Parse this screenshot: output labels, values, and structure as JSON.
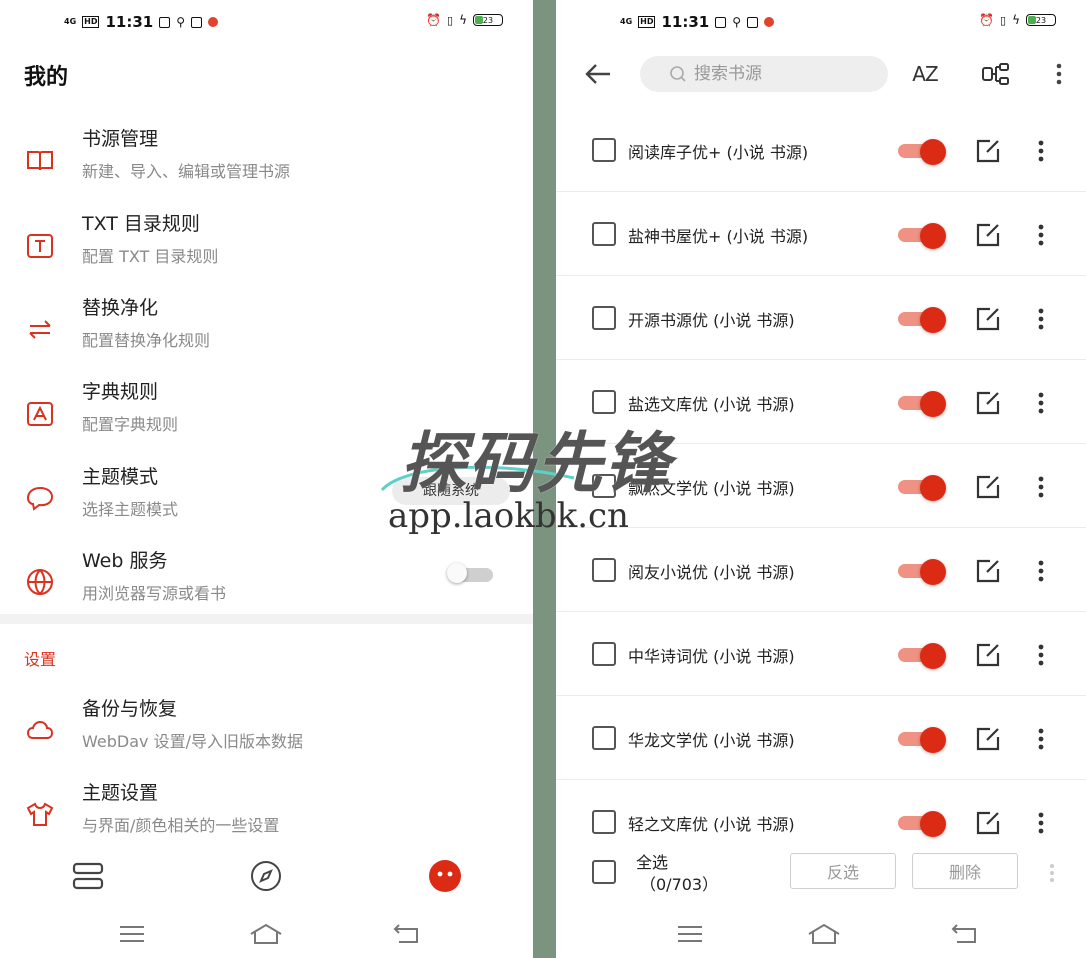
{
  "status_bar": {
    "left": {
      "net": "4G",
      "hd": "HD",
      "time": "11:31"
    },
    "right": {
      "battery": "23"
    }
  },
  "left": {
    "title": "我的",
    "menu": [
      {
        "icon": "book-open-icon",
        "title": "书源管理",
        "subtitle": "新建、导入、编辑或管理书源"
      },
      {
        "icon": "txt-icon",
        "title": "TXT 目录规则",
        "subtitle": "配置 TXT 目录规则"
      },
      {
        "icon": "replace-icon",
        "title": "替换净化",
        "subtitle": "配置替换净化规则"
      },
      {
        "icon": "dictionary-icon",
        "title": "字典规则",
        "subtitle": "配置字典规则"
      },
      {
        "icon": "theme-icon",
        "title": "主题模式",
        "subtitle": "选择主题模式",
        "value": "跟随系统"
      },
      {
        "icon": "globe-icon",
        "title": "Web 服务",
        "subtitle": "用浏览器写源或看书",
        "switch": false
      }
    ],
    "section_settings": "设置",
    "settings": [
      {
        "icon": "cloud-icon",
        "title": "备份与恢复",
        "subtitle": "WebDav 设置/导入旧版本数据"
      },
      {
        "icon": "shirt-icon",
        "title": "主题设置",
        "subtitle": "与界面/颜色相关的一些设置"
      }
    ],
    "bottom_nav": [
      "bookshelf-icon",
      "compass-icon",
      "profile-icon"
    ]
  },
  "right": {
    "search_placeholder": "搜索书源",
    "sort_label": "AZ",
    "sources": [
      {
        "name": "阅读库子优+ (小说 书源)",
        "enabled": true
      },
      {
        "name": "盐神书屋优+ (小说 书源)",
        "enabled": true
      },
      {
        "name": "开源书源优 (小说 书源)",
        "enabled": true
      },
      {
        "name": "盐选文库优 (小说 书源)",
        "enabled": true
      },
      {
        "name": "飘然文学优 (小说 书源)",
        "enabled": true
      },
      {
        "name": "阅友小说优 (小说 书源)",
        "enabled": true
      },
      {
        "name": "中华诗词优 (小说 书源)",
        "enabled": true
      },
      {
        "name": "华龙文学优 (小说 书源)",
        "enabled": true
      },
      {
        "name": "轻之文库优 (小说 书源)",
        "enabled": true
      }
    ],
    "footer": {
      "select_all": "全选",
      "count": "（0/703）",
      "invert": "反选",
      "delete": "删除"
    }
  },
  "watermark": {
    "title": "探码先锋",
    "url": "app.laokbk.cn"
  },
  "colors": {
    "accent": "#dc2b14",
    "accent_light": "#f09283",
    "divider": "#7b9480"
  }
}
